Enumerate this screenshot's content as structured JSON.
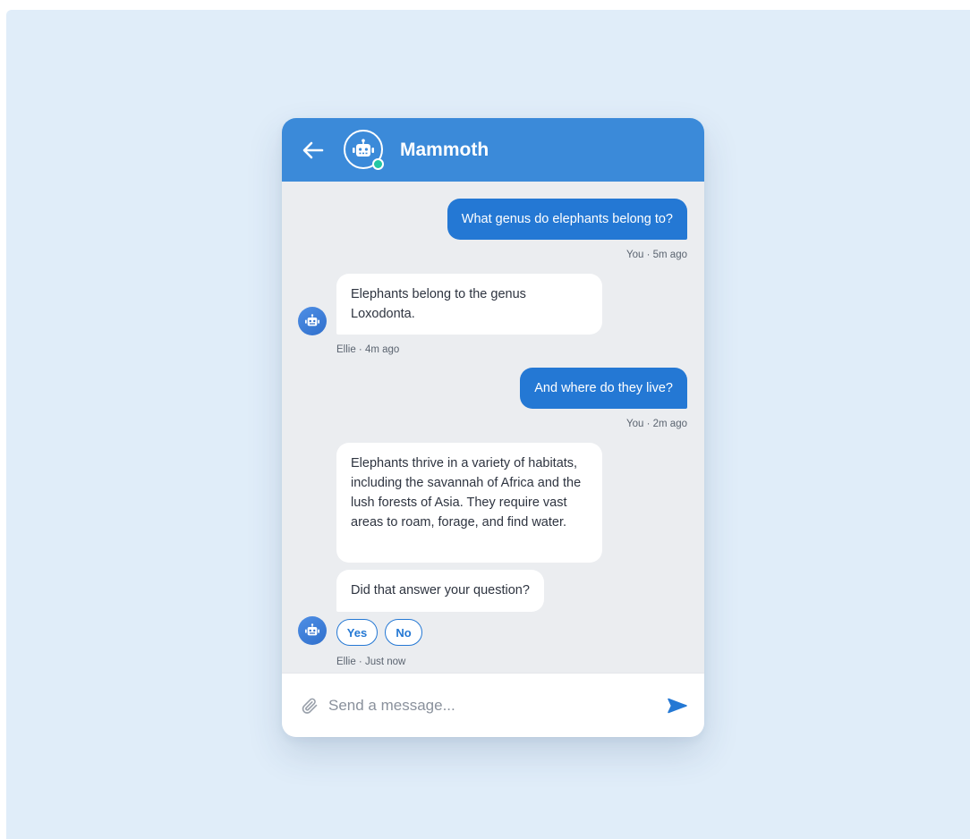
{
  "header": {
    "bot_name": "Mammoth",
    "back_icon": "arrow-left-icon",
    "avatar_icon": "robot-icon",
    "status": "online"
  },
  "messages": [
    {
      "sender": "user",
      "text": "What genus do elephants belong to?",
      "meta": "You · 5m ago"
    },
    {
      "sender": "bot",
      "text": "Elephants belong to the genus Loxodonta.",
      "meta": "Ellie · 4m ago"
    },
    {
      "sender": "user",
      "text": "And where do they live?",
      "meta": "You · 2m ago"
    },
    {
      "sender": "bot",
      "text": "Elephants thrive in a variety of habitats, including the savannah of Africa and the lush forests of Asia. They require vast areas to roam, forage, and find water."
    },
    {
      "sender": "bot",
      "text": "Did that answer your question?",
      "meta": "Ellie · Just now"
    }
  ],
  "quick_replies": [
    "Yes",
    "No"
  ],
  "composer": {
    "placeholder": "Send a message...",
    "attach_icon": "paperclip-icon",
    "send_icon": "send-icon"
  },
  "colors": {
    "background": "#e0edf9",
    "header": "#3b8ad9",
    "user_bubble": "#2478d4",
    "bot_bubble": "#ffffff",
    "chat_area": "#ebedf0",
    "online_dot": "#22c7a3"
  }
}
